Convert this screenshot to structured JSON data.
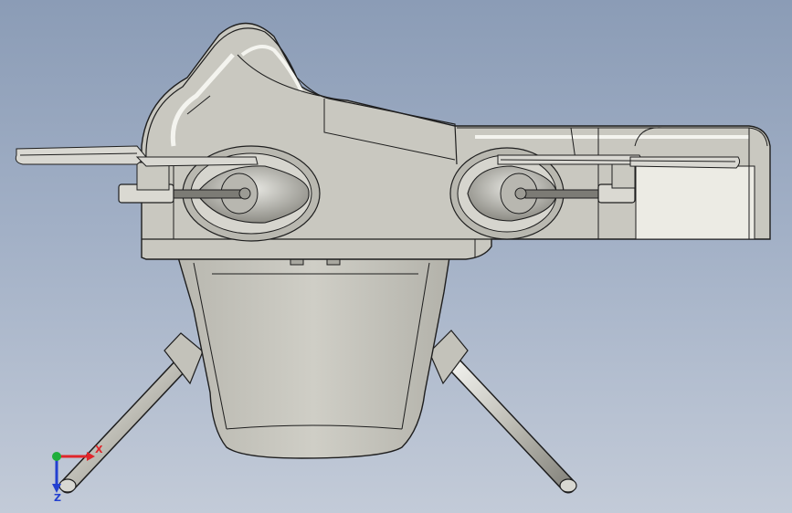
{
  "viewport": {
    "background_top": "#8b9cb6",
    "background_bottom": "#c3cbd8",
    "model_fill": "#c9c8c0",
    "model_edge": "#1e1e1e",
    "highlight": "#f2f2ee",
    "shadow": "#8e8d86"
  },
  "triad": {
    "x_label": "X",
    "z_label": "Z",
    "x_color": "#e0262b",
    "y_color": "#1fae3b",
    "z_color": "#2340d0"
  }
}
